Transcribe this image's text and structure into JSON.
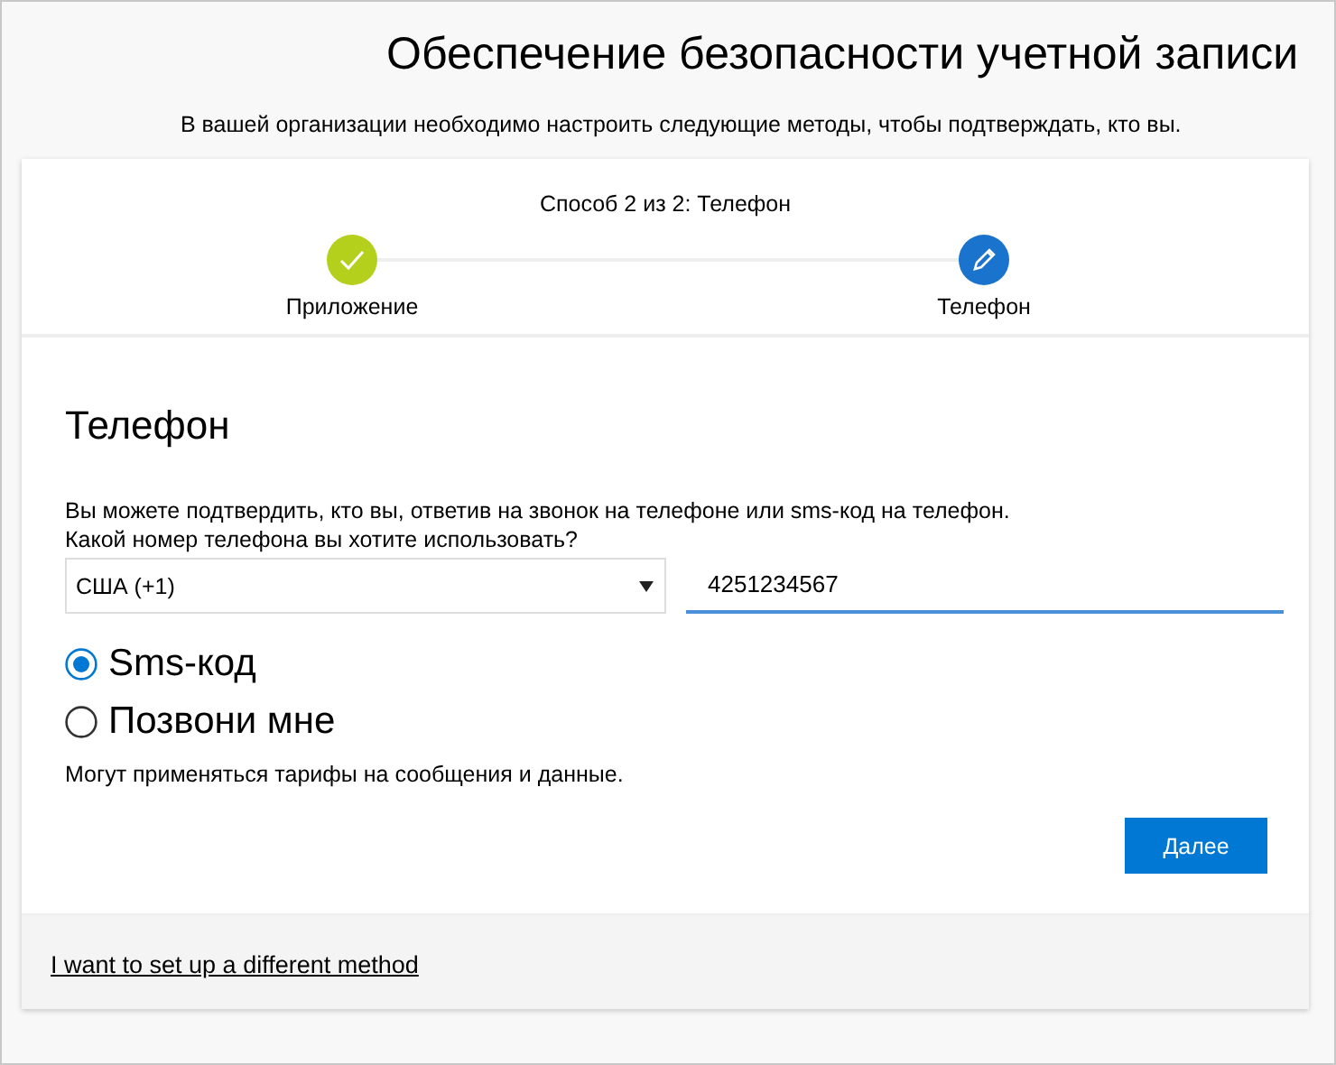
{
  "title": "Обеспечение безопасности учетной записи",
  "subtitle": "В вашей организации необходимо настроить следующие методы, чтобы подтверждать, кто вы.",
  "progress": {
    "caption": "Способ 2 из 2: Телефон",
    "steps": [
      {
        "label": "Приложение",
        "completed": true
      },
      {
        "label": "Телефон",
        "completed": false
      }
    ]
  },
  "section": {
    "heading": "Телефон",
    "description": "Вы можете подтвердить, кто вы, ответив на звонок на телефоне или sms-код на телефон.",
    "question": "Какой номер телефона вы хотите использовать?",
    "country": {
      "value": "США (+1)"
    },
    "phone": {
      "value": "4251234567"
    },
    "options": [
      {
        "label": "Sms-код",
        "selected": true
      },
      {
        "label": "Позвони мне",
        "selected": false
      }
    ],
    "note": "Могут применяться тарифы на сообщения и данные.",
    "next_button": "Далее"
  },
  "footer_link": "I want to set up a different method"
}
